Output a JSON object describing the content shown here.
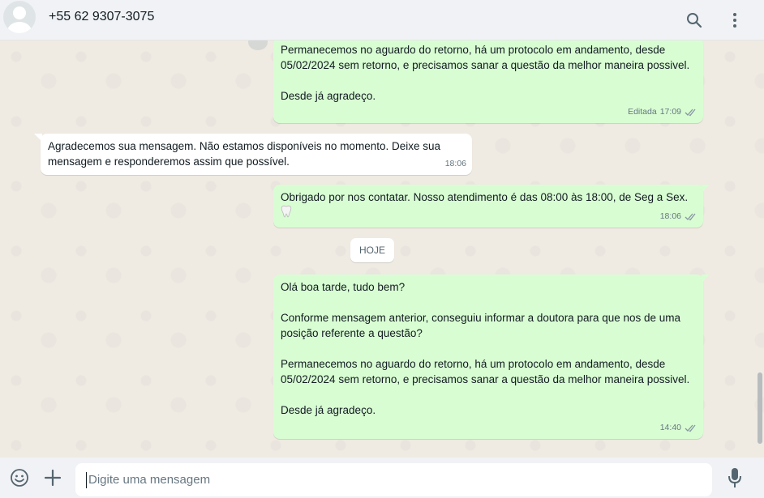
{
  "header": {
    "contact_name": "+55 62 9307-3075",
    "icons": [
      "search-icon",
      "menu-kebab-icon"
    ]
  },
  "messages": [
    {
      "direction": "outgoing",
      "text": "Permanecemos no aguardo do retorno, há um protocolo em andamento, desde 05/02/2024 sem retorno, e precisamos sanar a questão da melhor maneira possivel.\n\nDesde já agradeço.",
      "edited_label": "Editada",
      "time": "17:09",
      "status": "read"
    },
    {
      "direction": "incoming",
      "text": "Agradecemos sua mensagem. Não estamos disponíveis no momento. Deixe sua mensagem e responderemos assim que possível.",
      "time": "18:06"
    },
    {
      "direction": "outgoing",
      "text": "Obrigado por nos contatar. Nosso atendimento é das 08:00 às 18:00, de Seg a Sex.",
      "emoji": "tooth",
      "time": "18:06",
      "status": "read"
    },
    {
      "direction": "outgoing",
      "text": "Olá boa tarde, tudo bem?\n\nConforme mensagem anterior, conseguiu informar a doutora para que nos de uma posição referente a questão?\n\nPermanecemos no aguardo do retorno, há um protocolo em andamento, desde 05/02/2024 sem retorno, e precisamos sanar a questão da melhor maneira possivel.\n\nDesde já agradeço.",
      "time": "14:40",
      "status": "read"
    }
  ],
  "date_separator": "HOJE",
  "composer": {
    "placeholder": "Digite uma mensagem",
    "icons": [
      "emoji-icon",
      "plus-icon",
      "microphone-icon"
    ]
  },
  "colors": {
    "outgoing_bubble": "#d9fdd3",
    "incoming_bubble": "#ffffff",
    "chat_background": "#efeae2",
    "header_background": "#f0f2f5",
    "read_ticks": "#8696a0"
  }
}
